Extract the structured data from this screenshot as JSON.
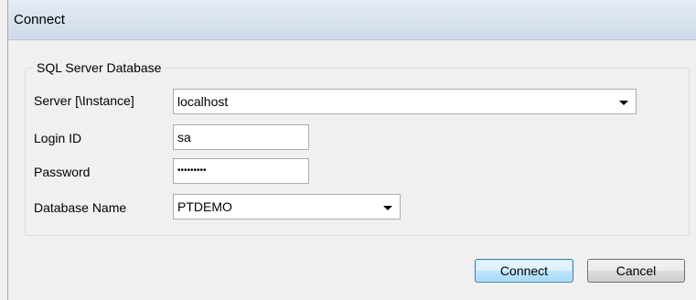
{
  "window": {
    "title": "Connect"
  },
  "group": {
    "title": "SQL Server Database"
  },
  "fields": {
    "server": {
      "label": "Server [\\Instance]",
      "value": "localhost"
    },
    "login": {
      "label": "Login ID",
      "value": "sa"
    },
    "password": {
      "label": "Password",
      "value": "•••••••••"
    },
    "database": {
      "label": "Database Name",
      "value": "PTDEMO"
    }
  },
  "buttons": {
    "connect": "Connect",
    "cancel": "Cancel"
  },
  "icons": {
    "dropdown": "chevron-down-icon"
  }
}
